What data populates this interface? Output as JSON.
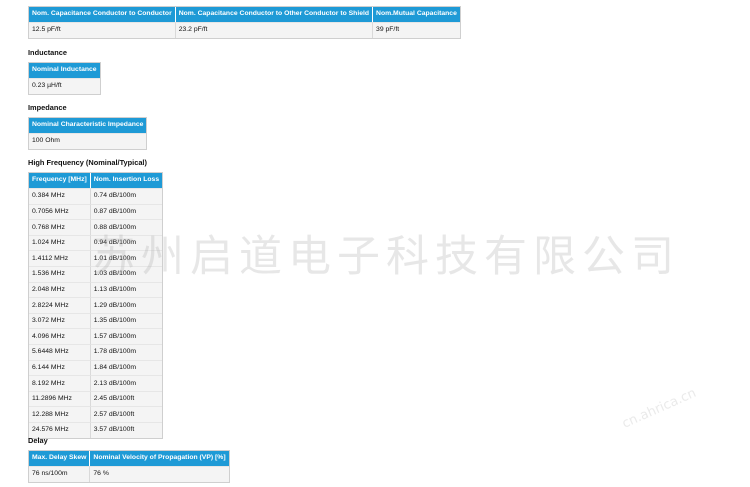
{
  "capacitance": {
    "headers": [
      "Nom. Capacitance Conductor to Conductor",
      "Nom. Capacitance Conductor to Other Conductor to Shield",
      "Nom.Mutual Capacitance"
    ],
    "values": [
      "12.5 pF/ft",
      "23.2 pF/ft",
      "39 pF/ft"
    ]
  },
  "inductance": {
    "title": "Inductance",
    "header": "Nominal Inductance",
    "value": "0.23 µH/ft"
  },
  "impedance": {
    "title": "Impedance",
    "header": "Nominal Characteristic Impedance",
    "value": "100 Ohm"
  },
  "high_frequency": {
    "title": "High Frequency (Nominal/Typical)",
    "headers": [
      "Frequency [MHz]",
      "Nom. Insertion Loss"
    ],
    "rows": [
      [
        "0.384 MHz",
        "0.74 dB/100m"
      ],
      [
        "0.7056 MHz",
        "0.87 dB/100m"
      ],
      [
        "0.768 MHz",
        "0.88 dB/100m"
      ],
      [
        "1.024 MHz",
        "0.94 dB/100m"
      ],
      [
        "1.4112 MHz",
        "1.01 dB/100m"
      ],
      [
        "1.536 MHz",
        "1.03 dB/100m"
      ],
      [
        "2.048 MHz",
        "1.13 dB/100m"
      ],
      [
        "2.8224 MHz",
        "1.29 dB/100m"
      ],
      [
        "3.072 MHz",
        "1.35 dB/100m"
      ],
      [
        "4.096 MHz",
        "1.57 dB/100m"
      ],
      [
        "5.6448 MHz",
        "1.78 dB/100m"
      ],
      [
        "6.144 MHz",
        "1.84 dB/100m"
      ],
      [
        "8.192 MHz",
        "2.13 dB/100m"
      ],
      [
        "11.2896 MHz",
        "2.45 dB/100ft"
      ],
      [
        "12.288 MHz",
        "2.57 dB/100ft"
      ],
      [
        "24.576 MHz",
        "3.57 dB/100ft"
      ]
    ]
  },
  "delay": {
    "title": "Delay",
    "headers": [
      "Max. Delay Skew",
      "Nominal Velocity of Propagation (VP) [%]"
    ],
    "values": [
      "76 ns/100m",
      "76 %"
    ]
  },
  "watermark": {
    "main": "苏州启道电子科技有限公司",
    "small": "cn.ahrica.cn"
  }
}
